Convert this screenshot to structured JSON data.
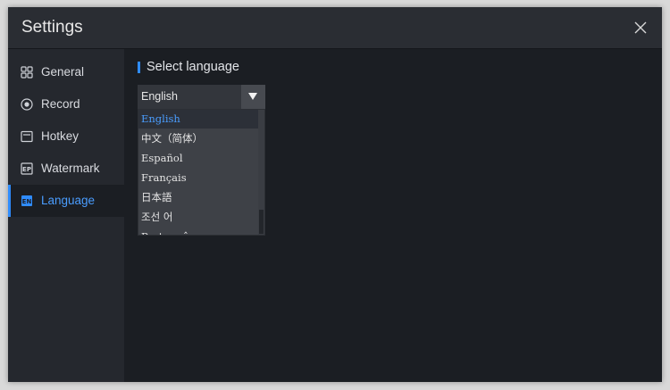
{
  "window": {
    "title": "Settings"
  },
  "sidebar": {
    "items": [
      {
        "label": "General",
        "icon": "grid-icon"
      },
      {
        "label": "Record",
        "icon": "record-icon"
      },
      {
        "label": "Hotkey",
        "icon": "keyboard-icon"
      },
      {
        "label": "Watermark",
        "icon": "watermark-icon"
      },
      {
        "label": "Language",
        "icon": "language-icon",
        "active": true
      }
    ]
  },
  "main": {
    "section_title": "Select language",
    "language_select": {
      "value": "English",
      "options": [
        "English",
        "中文（简体）",
        "Español",
        "Français",
        "日本語",
        "조선 어",
        "Português"
      ]
    }
  },
  "colors": {
    "accent": "#2f8cff",
    "background": "#1b1e23",
    "sidebar": "#25282e"
  }
}
